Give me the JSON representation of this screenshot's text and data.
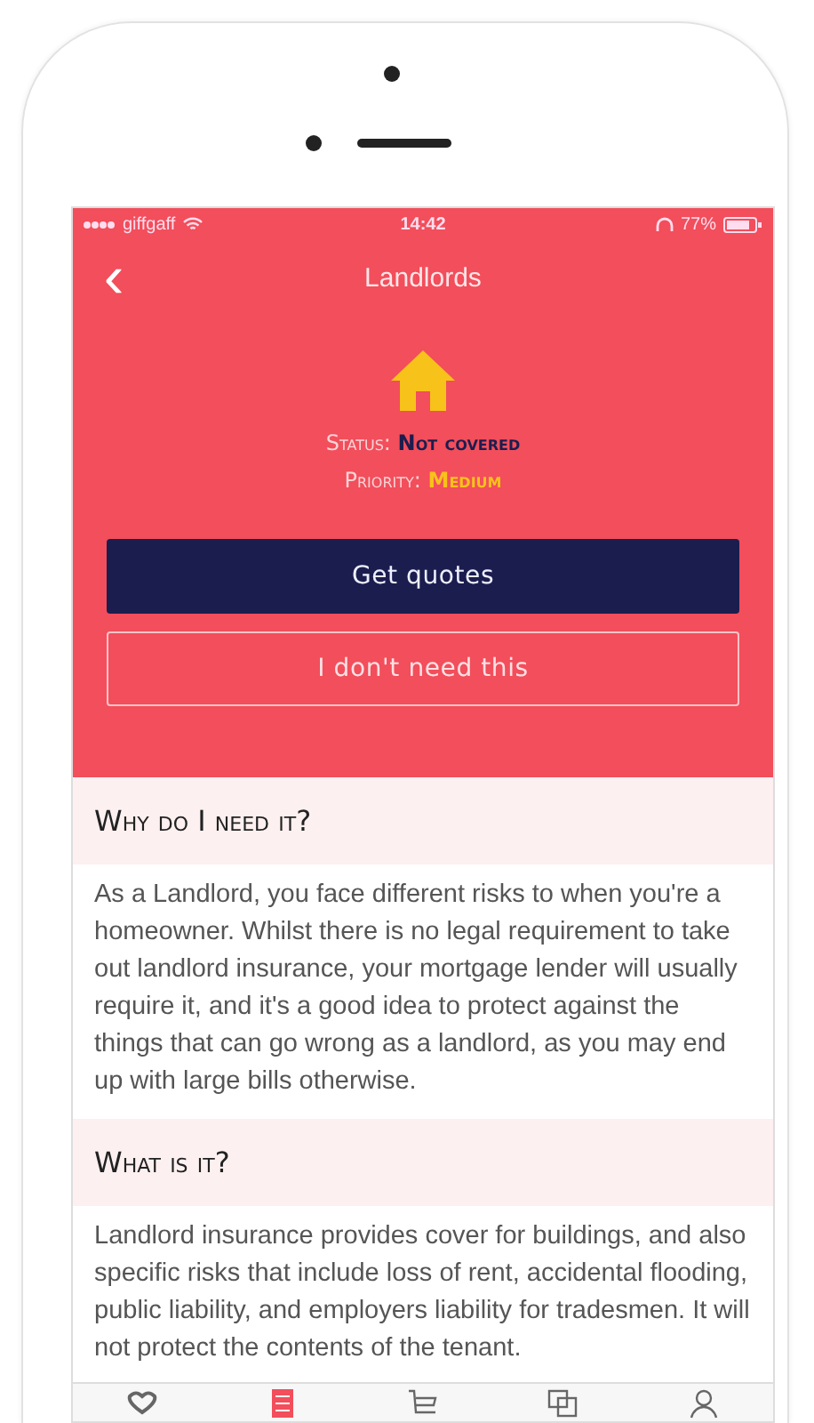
{
  "status_bar": {
    "carrier": "giffgaff",
    "time": "14:42",
    "battery": "77%"
  },
  "nav": {
    "back": "‹",
    "title": "Landlords"
  },
  "summary": {
    "status_label": "Status:",
    "status_value": "Not covered",
    "priority_label": "Priority:",
    "priority_value": "Medium"
  },
  "buttons": [
    {
      "label": "Get quotes",
      "kind": "primary"
    },
    {
      "label": "I don't need this",
      "kind": "outline"
    }
  ],
  "sections": [
    {
      "heading": "Why do I need it?",
      "body": "As a Landlord, you face different risks to when you're a homeowner. Whilst there is no legal requirement to take out landlord insurance, your mortgage lender will usually require it, and it's a good idea to protect against the things that can go wrong as a landlord, as you may end up with large bills otherwise."
    },
    {
      "heading": "What is it?",
      "body": "Landlord insurance provides cover for buildings, and also specific risks that include loss of rent, accidental flooding, public liability, and employers liability for tradesmen. It will not protect the contents of the tenant."
    }
  ],
  "tab_bar": [
    {
      "kind": "heart",
      "selected": false
    },
    {
      "kind": "list",
      "selected": true
    },
    {
      "kind": "cart",
      "selected": false
    },
    {
      "kind": "copy",
      "selected": false
    },
    {
      "kind": "person",
      "selected": false
    }
  ]
}
